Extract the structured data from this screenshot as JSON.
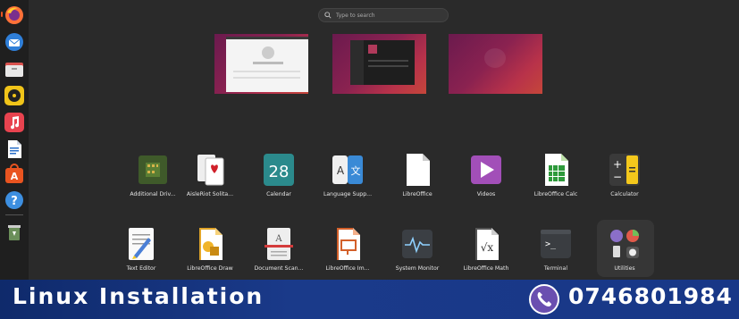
{
  "search": {
    "placeholder": "Type to search"
  },
  "dock": {
    "items": [
      "firefox-icon",
      "thunderbird-icon",
      "files-icon",
      "rhythmbox-icon",
      "music-icon",
      "writer-icon",
      "software-icon",
      "help-icon",
      "trash-icon"
    ]
  },
  "workspaces": [
    "Workspace 1",
    "Workspace 2",
    "Workspace 3"
  ],
  "apps": {
    "row1": [
      "Additional Driv...",
      "AisleRiot Solita...",
      "Calendar",
      "Language Supp...",
      "LibreOffice",
      "Videos",
      "LibreOffice Calc",
      "Calculator"
    ],
    "row2": [
      "Text Editor",
      "LibreOffice Draw",
      "Document Scan...",
      "LibreOffice Im...",
      "System Monitor",
      "LibreOffice Math",
      "Terminal",
      "Utilities"
    ],
    "calendar_day": "28",
    "language_glyphs": [
      "A",
      "文"
    ],
    "terminal_prompt": ">_",
    "math_glyph": "√x"
  },
  "banner": {
    "title": "Linux Installation",
    "phone": "0746801984"
  },
  "colors": {
    "accent": "#e95420",
    "banner": "#1a3a8a",
    "background": "#2a2a2a"
  }
}
